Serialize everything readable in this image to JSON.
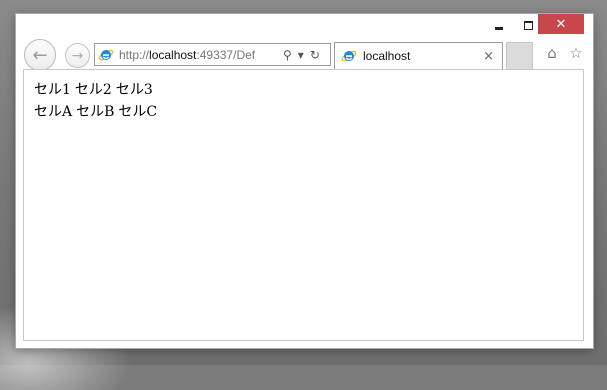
{
  "window": {
    "close_glyph": "✕",
    "minimize_glyph": "",
    "maximize_glyph": ""
  },
  "nav": {
    "back_icon": "back-arrow-icon",
    "forward_icon": "forward-arrow-icon",
    "back_glyph": "←",
    "forward_glyph": "→"
  },
  "address_bar": {
    "protocol": "http://",
    "host": "localhost",
    "rest": ":49337/Def",
    "search_glyph": "⚲",
    "dropdown_glyph": "▾",
    "refresh_glyph": "↻"
  },
  "tab": {
    "title": "localhost",
    "close_glyph": "×"
  },
  "toolbar": {
    "home_glyph": "⌂",
    "favorites_glyph": "☆"
  },
  "page": {
    "rows": [
      [
        "セル1",
        "セル2",
        "セル3"
      ],
      [
        "セルA",
        "セルB",
        "セルC"
      ]
    ]
  },
  "colors": {
    "close_button": "#c7474d",
    "ie_blue": "#1b8ad8",
    "ie_gold": "#f2b81a"
  }
}
